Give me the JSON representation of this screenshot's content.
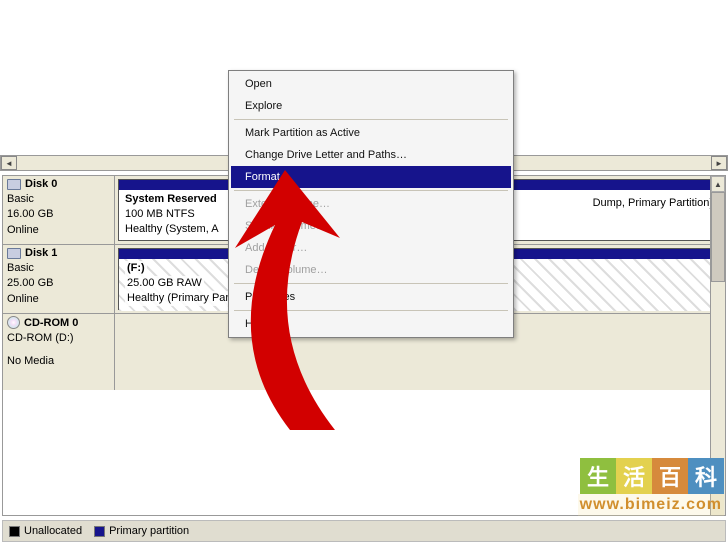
{
  "context_menu": {
    "items": [
      {
        "label": "Open",
        "enabled": true
      },
      {
        "label": "Explore",
        "enabled": true
      }
    ],
    "items2": [
      {
        "label": "Mark Partition as Active",
        "enabled": true
      },
      {
        "label": "Change Drive Letter and Paths…",
        "enabled": true
      },
      {
        "label": "Format…",
        "enabled": true,
        "highlighted": true
      }
    ],
    "items3": [
      {
        "label": "Extend Volume…",
        "enabled": false
      },
      {
        "label": "Shrink Volume…",
        "enabled": false
      },
      {
        "label": "Add Mirror…",
        "enabled": false
      },
      {
        "label": "Delete Volume…",
        "enabled": false
      }
    ],
    "items4": [
      {
        "label": "Properties",
        "enabled": true
      }
    ],
    "items5": [
      {
        "label": "Help",
        "enabled": true
      }
    ]
  },
  "disks": {
    "disk0": {
      "title": "Disk 0",
      "kind": "Basic",
      "size": "16.00 GB",
      "status": "Online",
      "partA": {
        "name": "System Reserved",
        "line1": "100 MB NTFS",
        "line2": "Healthy (System, A"
      },
      "partB": {
        "right": "Dump, Primary Partition)"
      }
    },
    "disk1": {
      "title": "Disk 1",
      "kind": "Basic",
      "size": "25.00 GB",
      "status": "Online",
      "part": {
        "name": "(F:)",
        "line1": "25.00 GB RAW",
        "line2": "Healthy (Primary Par"
      }
    },
    "cdrom": {
      "title": "CD-ROM 0",
      "label": "CD-ROM (D:)",
      "nomedia": "No Media"
    }
  },
  "legend": {
    "unallocated": "Unallocated",
    "primary": "Primary partition"
  },
  "watermark": {
    "c1": "生",
    "c2": "活",
    "c3": "百",
    "c4": "科",
    "url": "www.bimeiz.com"
  }
}
